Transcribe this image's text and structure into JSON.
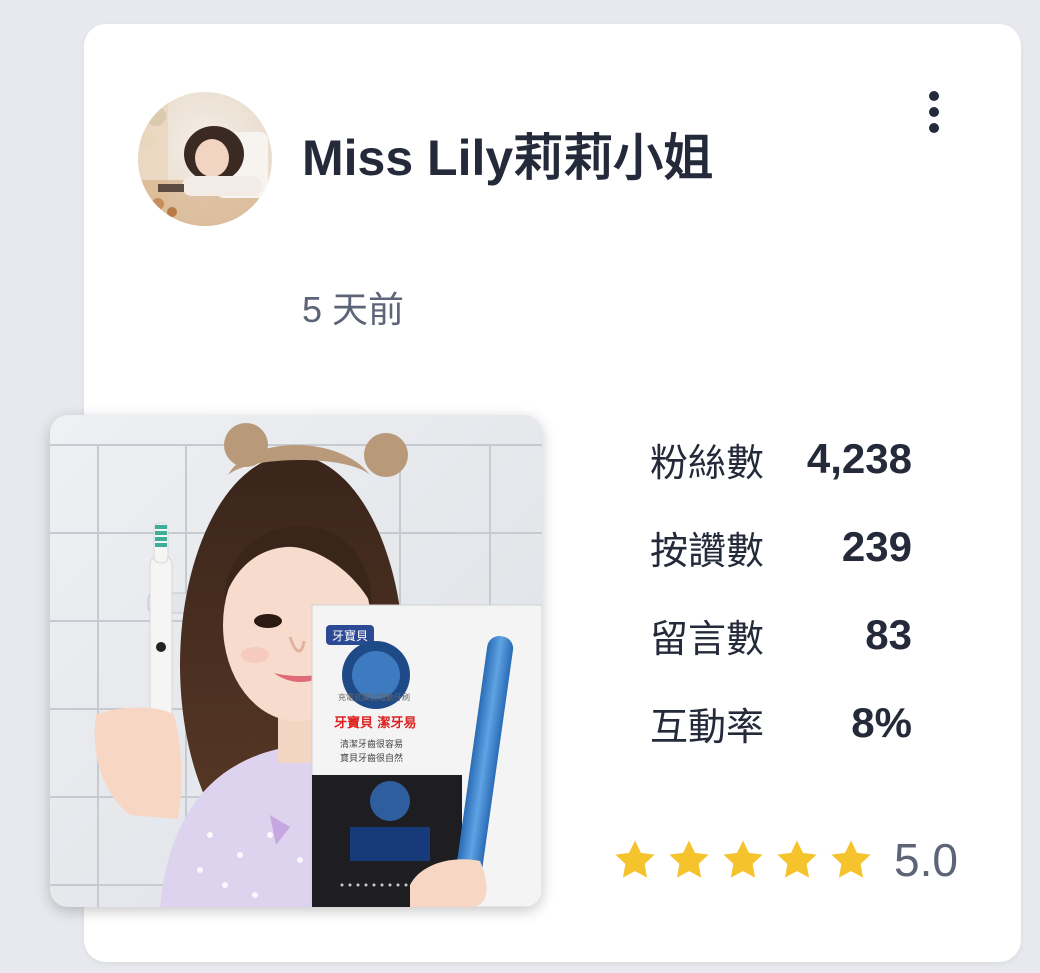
{
  "post": {
    "author": "Miss Lily莉莉小姐",
    "time": "5 天前"
  },
  "stats": [
    {
      "label": "粉絲數",
      "value": "4,238"
    },
    {
      "label": "按讚數",
      "value": "239"
    },
    {
      "label": "留言數",
      "value": "83"
    },
    {
      "label": "互動率",
      "value": "8%"
    }
  ],
  "rating": {
    "stars": 5,
    "value": "5.0",
    "star_color": "#f5c32c"
  },
  "colors": {
    "text_primary": "#252a3a",
    "text_secondary": "#5d6477",
    "card_background": "#ffffff",
    "page_background": "#e7e9ee"
  },
  "image_text": {
    "brand": "牙寶貝",
    "product_line": "牙寶貝 潔牙易",
    "subtitle": "充電式聲波電動牙刷",
    "tagline_1": "清潔牙齒很容易",
    "tagline_2": "寶貝牙齒很自然"
  },
  "icons": {
    "menu": "more-vertical-icon",
    "star": "star-icon"
  }
}
